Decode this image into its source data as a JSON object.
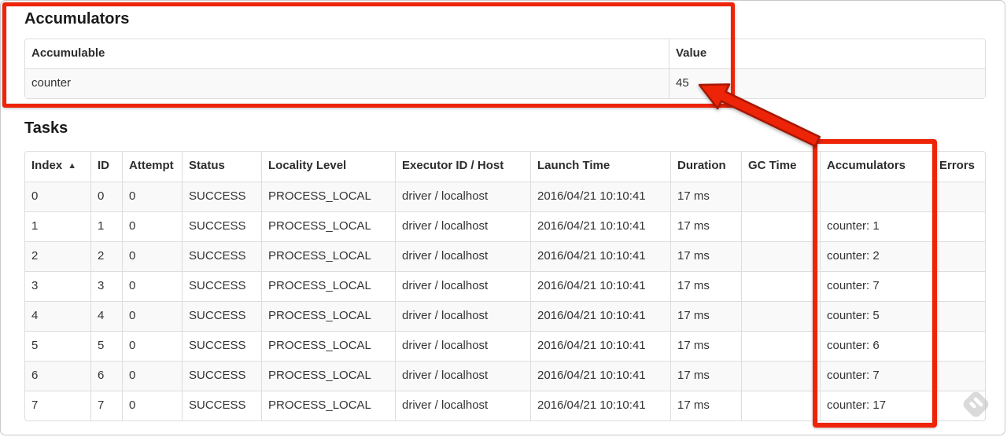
{
  "colors": {
    "annotation-red": "#ee2409",
    "annotation-red-dark": "#a81703",
    "table-border": "#dddddd",
    "row-stripe": "#f9f9f9",
    "text": "#333333",
    "heading": "#1a1a1a",
    "watermark-gray": "#bcbcbc"
  },
  "accumulators_section": {
    "title": "Accumulators",
    "table": {
      "headers": [
        "Accumulable",
        "Value"
      ],
      "rows": [
        [
          "counter",
          "45"
        ]
      ]
    }
  },
  "tasks_section": {
    "title": "Tasks",
    "table": {
      "sort_ascending_icon": "▲",
      "headers": [
        "Index",
        "ID",
        "Attempt",
        "Status",
        "Locality Level",
        "Executor ID / Host",
        "Launch Time",
        "Duration",
        "GC Time",
        "Accumulators",
        "Errors"
      ],
      "rows": [
        [
          "0",
          "0",
          "0",
          "SUCCESS",
          "PROCESS_LOCAL",
          "driver / localhost",
          "2016/04/21 10:10:41",
          "17 ms",
          "",
          "",
          ""
        ],
        [
          "1",
          "1",
          "0",
          "SUCCESS",
          "PROCESS_LOCAL",
          "driver / localhost",
          "2016/04/21 10:10:41",
          "17 ms",
          "",
          "counter: 1",
          ""
        ],
        [
          "2",
          "2",
          "0",
          "SUCCESS",
          "PROCESS_LOCAL",
          "driver / localhost",
          "2016/04/21 10:10:41",
          "17 ms",
          "",
          "counter: 2",
          ""
        ],
        [
          "3",
          "3",
          "0",
          "SUCCESS",
          "PROCESS_LOCAL",
          "driver / localhost",
          "2016/04/21 10:10:41",
          "17 ms",
          "",
          "counter: 7",
          ""
        ],
        [
          "4",
          "4",
          "0",
          "SUCCESS",
          "PROCESS_LOCAL",
          "driver / localhost",
          "2016/04/21 10:10:41",
          "17 ms",
          "",
          "counter: 5",
          ""
        ],
        [
          "5",
          "5",
          "0",
          "SUCCESS",
          "PROCESS_LOCAL",
          "driver / localhost",
          "2016/04/21 10:10:41",
          "17 ms",
          "",
          "counter: 6",
          ""
        ],
        [
          "6",
          "6",
          "0",
          "SUCCESS",
          "PROCESS_LOCAL",
          "driver / localhost",
          "2016/04/21 10:10:41",
          "17 ms",
          "",
          "counter: 7",
          ""
        ],
        [
          "7",
          "7",
          "0",
          "SUCCESS",
          "PROCESS_LOCAL",
          "driver / localhost",
          "2016/04/21 10:10:41",
          "17 ms",
          "",
          "counter: 17",
          ""
        ]
      ]
    }
  }
}
